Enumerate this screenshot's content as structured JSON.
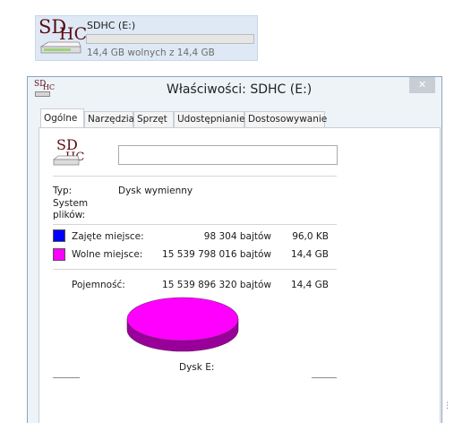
{
  "explorer": {
    "drive_logo": {
      "line1": "SD",
      "line2": "HC"
    },
    "drive_name": "SDHC (E:)",
    "drive_free_text": "14,4 GB wolnych z 14,4 GB",
    "drive_used_fraction": 0.0
  },
  "dialog": {
    "title": "Właściwości: SDHC (E:)",
    "title_logo": {
      "line1": "SD",
      "line2": "HC"
    },
    "close_glyph": "✕",
    "tabs": [
      {
        "label": "Ogólne"
      },
      {
        "label": "Narzędzia"
      },
      {
        "label": "Sprzęt"
      },
      {
        "label": "Udostępnianie"
      },
      {
        "label": "Dostosowywanie"
      }
    ],
    "general": {
      "drive_logo": {
        "line1": "SD",
        "line2": "HC"
      },
      "label_value": "",
      "type_label": "Typ:",
      "type_value": "Dysk wymienny",
      "fs_label_line1": "System",
      "fs_label_line2": "plików:",
      "fs_value": "",
      "used_label": "Zajęte miejsce:",
      "used_bytes": "98 304 bajtów",
      "used_size": "96,0 KB",
      "used_color": "#0000ff",
      "free_label": "Wolne miejsce:",
      "free_bytes": "15 539 798 016 bajtów",
      "free_size": "14,4 GB",
      "free_color": "#ff00ff",
      "capacity_label": "Pojemność:",
      "capacity_bytes": "15 539 896 320 bajtów",
      "capacity_size": "14,4 GB",
      "disk_caption": "Dysk E:"
    }
  },
  "chart_data": {
    "type": "pie",
    "categories": [
      "Zajęte miejsce",
      "Wolne miejsce"
    ],
    "values": [
      98304,
      15539798016
    ],
    "colors": [
      "#0000ff",
      "#ff00ff"
    ],
    "title": "Dysk E:"
  }
}
